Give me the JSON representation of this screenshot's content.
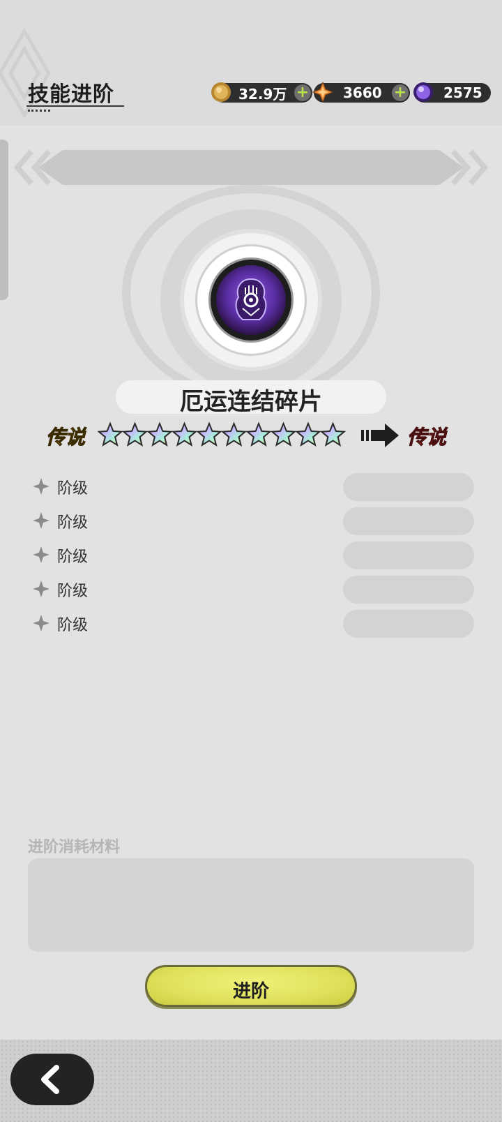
{
  "header": {
    "title": "技能进阶"
  },
  "currencies": [
    {
      "name": "gold-coin",
      "value": "32.9万",
      "has_plus": true
    },
    {
      "name": "star-crystal",
      "value": "3660",
      "has_plus": true
    },
    {
      "name": "purple-orb",
      "value": "2575",
      "has_plus": false
    }
  ],
  "skill": {
    "name": "厄运连结碎片",
    "icon": "purple-figure-icon",
    "rarity_from": "传说",
    "rarity_to": "传说",
    "stars": 10
  },
  "tiers": [
    {
      "label": "阶级"
    },
    {
      "label": "阶级"
    },
    {
      "label": "阶级"
    },
    {
      "label": "阶级"
    },
    {
      "label": "阶级"
    }
  ],
  "materials": {
    "title": "进阶消耗材料"
  },
  "actions": {
    "advance_label": "进阶"
  },
  "colors": {
    "accent": "#dfe15c",
    "rarity_from": "#f2c232",
    "rarity_to": "#f05050"
  }
}
